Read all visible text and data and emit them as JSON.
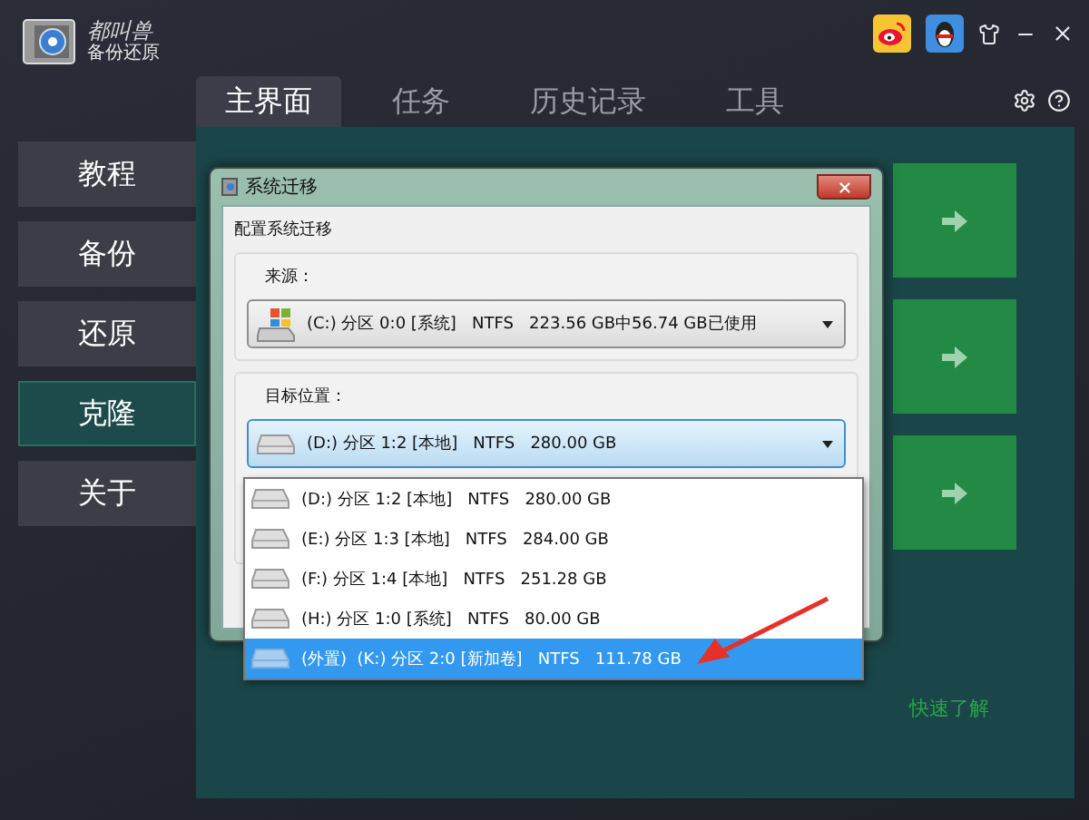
{
  "app": {
    "brand": "都叫兽",
    "subtitle": "备份还原"
  },
  "tabs": [
    {
      "label": "主界面",
      "selected": true
    },
    {
      "label": "任务",
      "selected": false
    },
    {
      "label": "历史记录",
      "selected": false
    },
    {
      "label": "工具",
      "selected": false
    }
  ],
  "sidebar": [
    {
      "label": "教程",
      "selected": false
    },
    {
      "label": "备份",
      "selected": false
    },
    {
      "label": "还原",
      "selected": false
    },
    {
      "label": "克隆",
      "selected": true
    },
    {
      "label": "关于",
      "selected": false
    }
  ],
  "dialog": {
    "title": "系统迁移",
    "heading": "配置系统迁移",
    "source": {
      "label": "来源：",
      "value": "(C:) 分区 0:0 [系统]   NTFS   223.56 GB中56.74 GB已使用"
    },
    "target": {
      "label": "目标位置：",
      "value": "(D:) 分区 1:2 [本地]   NTFS   280.00 GB"
    },
    "options": [
      {
        "text": "(D:) 分区 1:2 [本地]   NTFS   280.00 GB",
        "selected": false
      },
      {
        "text": "(E:) 分区 1:3 [本地]   NTFS   284.00 GB",
        "selected": false
      },
      {
        "text": "(F:) 分区 1:4 [本地]   NTFS   251.28 GB",
        "selected": false
      },
      {
        "text": "(H:) 分区 1:0 [系统]   NTFS   80.00 GB",
        "selected": false
      },
      {
        "text": "(外置)  (K:) 分区 2:0 [新加卷]   NTFS   111.78 GB",
        "selected": true
      }
    ]
  },
  "quick_link": "快速了解"
}
